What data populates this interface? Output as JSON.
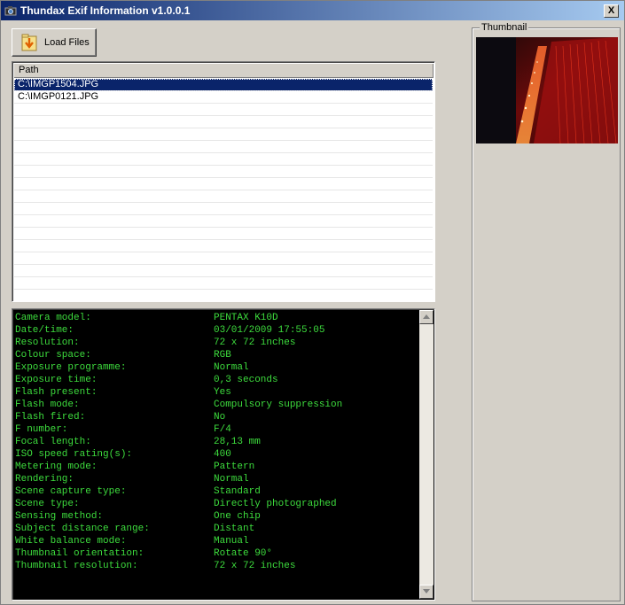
{
  "window": {
    "title": "Thundax Exif Information v1.0.0.1",
    "close_label": "X"
  },
  "toolbar": {
    "load_label": "Load Files"
  },
  "file_list": {
    "column_header": "Path",
    "rows": [
      "C:\\IMGP1504.JPG",
      "C:\\IMGP0121.JPG"
    ],
    "selected_index": 0
  },
  "exif": [
    {
      "label": "Camera model:",
      "value": "PENTAX K10D"
    },
    {
      "label": "Date/time:",
      "value": "03/01/2009 17:55:05"
    },
    {
      "label": "Resolution:",
      "value": "72 x 72 inches"
    },
    {
      "label": "Colour space:",
      "value": "RGB"
    },
    {
      "label": "Exposure programme:",
      "value": "Normal"
    },
    {
      "label": "Exposure time:",
      "value": "0,3 seconds"
    },
    {
      "label": "Flash present:",
      "value": "Yes"
    },
    {
      "label": "Flash mode:",
      "value": "Compulsory suppression"
    },
    {
      "label": "Flash fired:",
      "value": "No"
    },
    {
      "label": "F number:",
      "value": "F/4"
    },
    {
      "label": "Focal length:",
      "value": "28,13 mm"
    },
    {
      "label": "ISO speed rating(s):",
      "value": "400"
    },
    {
      "label": "Metering mode:",
      "value": "Pattern"
    },
    {
      "label": "Rendering:",
      "value": "Normal"
    },
    {
      "label": "Scene capture type:",
      "value": "Standard"
    },
    {
      "label": "Scene type:",
      "value": "Directly photographed"
    },
    {
      "label": "Sensing method:",
      "value": "One chip"
    },
    {
      "label": "Subject distance range:",
      "value": "Distant"
    },
    {
      "label": "White balance mode:",
      "value": "Manual"
    },
    {
      "label": "Thumbnail orientation:",
      "value": "Rotate 90°"
    },
    {
      "label": "Thumbnail resolution:",
      "value": "72 x 72 inches"
    }
  ],
  "thumbnail": {
    "legend": "Thumbnail"
  },
  "colors": {
    "title_start": "#0a246a",
    "title_end": "#a6caf0",
    "memo_text": "#3ddc3d",
    "memo_bg": "#000000",
    "selection": "#0a246a"
  },
  "icons": {
    "app": "camera-icon",
    "load": "folder-download-icon",
    "close": "close-icon",
    "scroll_up": "arrow-up-icon",
    "scroll_down": "arrow-down-icon"
  }
}
